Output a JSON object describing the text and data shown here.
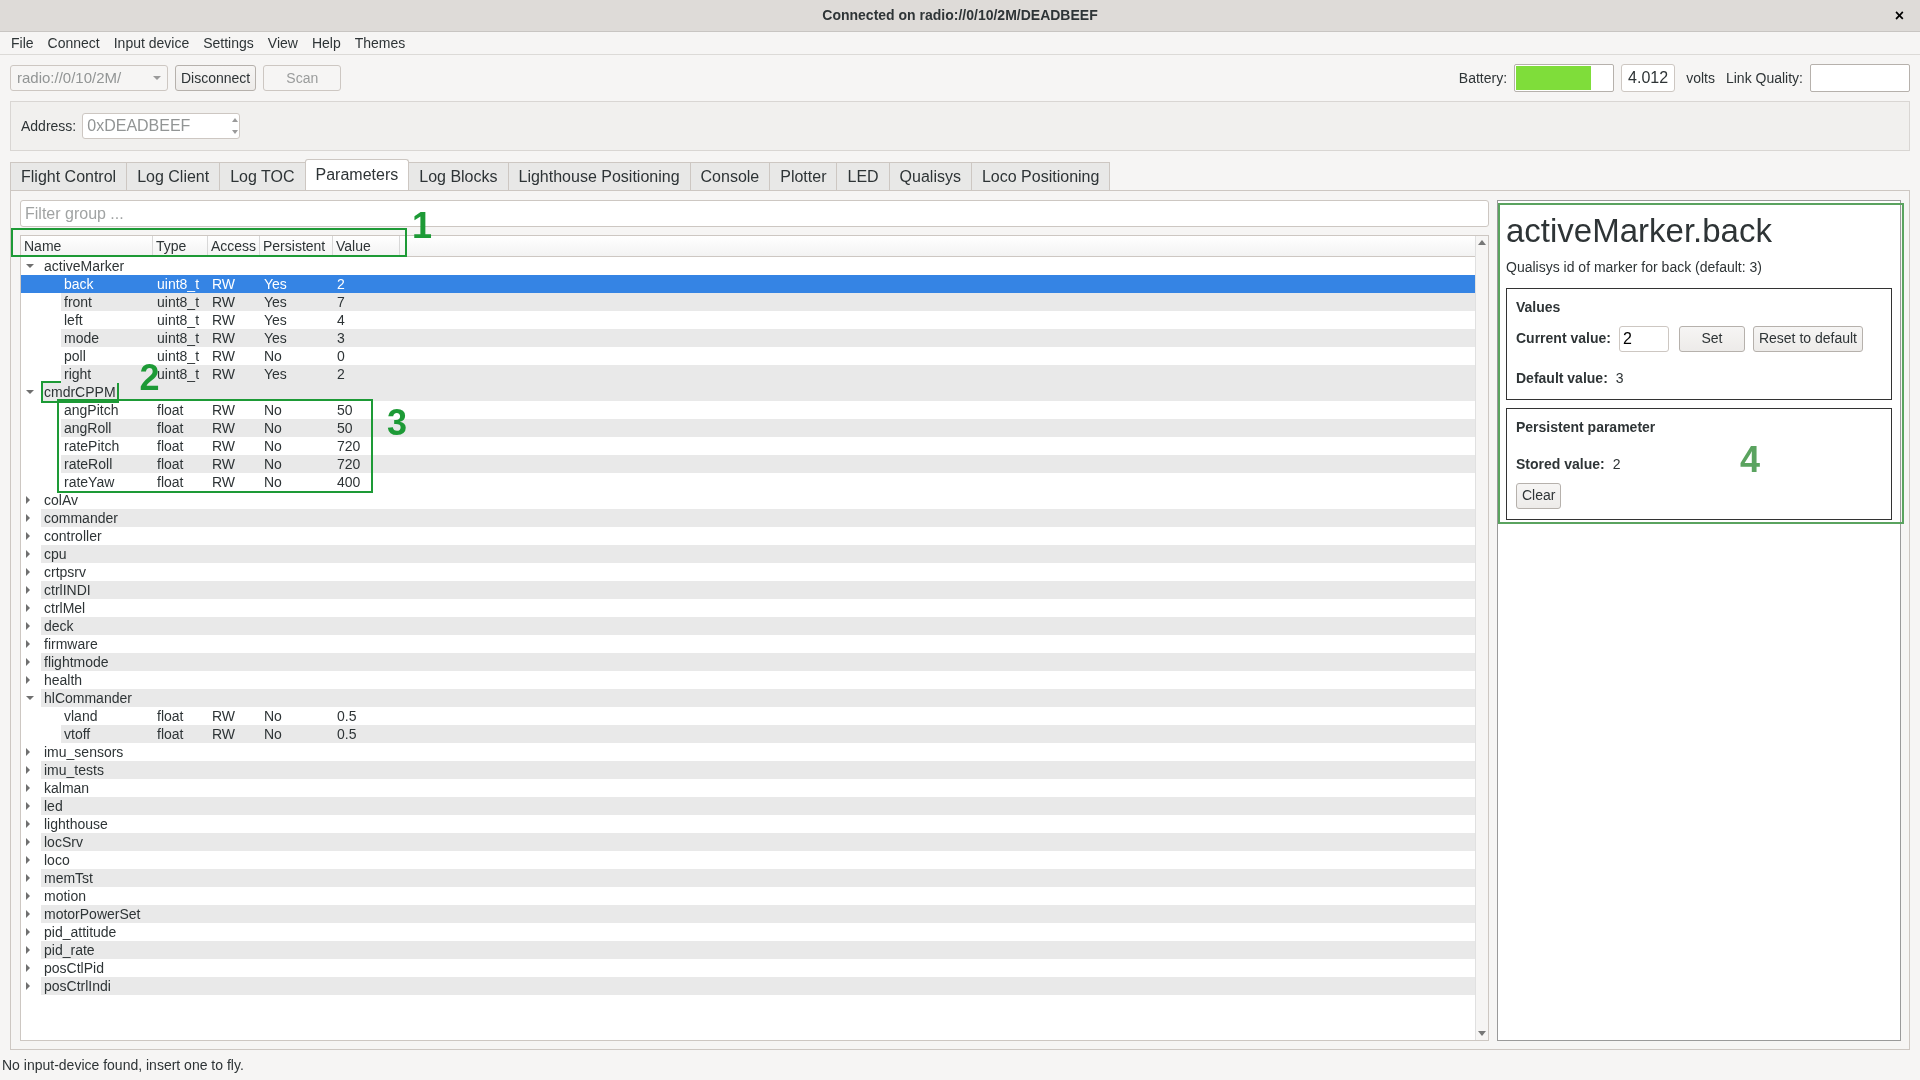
{
  "window": {
    "title": "Connected on radio://0/10/2M/DEADBEEF",
    "close": "×"
  },
  "menu": [
    "File",
    "Connect",
    "Input device",
    "Settings",
    "View",
    "Help",
    "Themes"
  ],
  "toolbar": {
    "uri": {
      "value": "radio://0/10/2M/",
      "disabled": true
    },
    "buttons": [
      {
        "label": "Disconnect",
        "disabled": false
      },
      {
        "label": "Scan",
        "disabled": true
      }
    ],
    "battery_label": "Battery:",
    "battery": {
      "level": 0.78
    },
    "voltage": "4.012",
    "voltage_unit": "volts",
    "link_quality_label": "Link Quality:"
  },
  "address": {
    "label": "Address:",
    "value": "0xDEADBEEF",
    "disabled": true
  },
  "tabs": [
    {
      "label": "Flight Control",
      "selected": false
    },
    {
      "label": "Log Client",
      "selected": false
    },
    {
      "label": "Log TOC",
      "selected": false
    },
    {
      "label": "Parameters",
      "selected": true
    },
    {
      "label": "Log Blocks",
      "selected": false
    },
    {
      "label": "Lighthouse Positioning",
      "selected": false
    },
    {
      "label": "Console",
      "selected": false
    },
    {
      "label": "Plotter",
      "selected": false
    },
    {
      "label": "LED",
      "selected": false
    },
    {
      "label": "Qualisys",
      "selected": false
    },
    {
      "label": "Loco Positioning",
      "selected": false
    }
  ],
  "filter": {
    "placeholder": "Filter group ..."
  },
  "tree": {
    "columns": [
      "Name",
      "Type",
      "Access",
      "Persistent",
      "Value"
    ],
    "callout": "1",
    "items": [
      {
        "kind": "group",
        "name": "activeMarker",
        "expanded": true,
        "selected": false,
        "children": [
          {
            "kind": "param",
            "name": "back",
            "type": "uint8_t",
            "access": "RW",
            "persistent": "Yes",
            "value": "2",
            "selected": true
          },
          {
            "kind": "param",
            "name": "front",
            "type": "uint8_t",
            "access": "RW",
            "persistent": "Yes",
            "value": "7",
            "selected": false
          },
          {
            "kind": "param",
            "name": "left",
            "type": "uint8_t",
            "access": "RW",
            "persistent": "Yes",
            "value": "4",
            "selected": false
          },
          {
            "kind": "param",
            "name": "mode",
            "type": "uint8_t",
            "access": "RW",
            "persistent": "Yes",
            "value": "3",
            "selected": false
          },
          {
            "kind": "param",
            "name": "poll",
            "type": "uint8_t",
            "access": "RW",
            "persistent": "No",
            "value": "0",
            "selected": false
          },
          {
            "kind": "param",
            "name": "right",
            "type": "uint8_t",
            "access": "RW",
            "persistent": "Yes",
            "value": "2",
            "selected": false
          }
        ]
      },
      {
        "kind": "group",
        "name": "cmdrCPPM",
        "expanded": true,
        "selected": false,
        "callout": "2",
        "children_callout": "3",
        "children": [
          {
            "kind": "param",
            "name": "angPitch",
            "type": "float",
            "access": "RW",
            "persistent": "No",
            "value": "50",
            "selected": false
          },
          {
            "kind": "param",
            "name": "angRoll",
            "type": "float",
            "access": "RW",
            "persistent": "No",
            "value": "50",
            "selected": false
          },
          {
            "kind": "param",
            "name": "ratePitch",
            "type": "float",
            "access": "RW",
            "persistent": "No",
            "value": "720",
            "selected": false
          },
          {
            "kind": "param",
            "name": "rateRoll",
            "type": "float",
            "access": "RW",
            "persistent": "No",
            "value": "720",
            "selected": false
          },
          {
            "kind": "param",
            "name": "rateYaw",
            "type": "float",
            "access": "RW",
            "persistent": "No",
            "value": "400",
            "selected": false
          }
        ]
      },
      {
        "kind": "group",
        "name": "colAv",
        "expanded": false,
        "selected": false
      },
      {
        "kind": "group",
        "name": "commander",
        "expanded": false,
        "selected": false
      },
      {
        "kind": "group",
        "name": "controller",
        "expanded": false,
        "selected": false
      },
      {
        "kind": "group",
        "name": "cpu",
        "expanded": false,
        "selected": false
      },
      {
        "kind": "group",
        "name": "crtpsrv",
        "expanded": false,
        "selected": false
      },
      {
        "kind": "group",
        "name": "ctrlINDI",
        "expanded": false,
        "selected": false
      },
      {
        "kind": "group",
        "name": "ctrlMel",
        "expanded": false,
        "selected": false
      },
      {
        "kind": "group",
        "name": "deck",
        "expanded": false,
        "selected": false
      },
      {
        "kind": "group",
        "name": "firmware",
        "expanded": false,
        "selected": false
      },
      {
        "kind": "group",
        "name": "flightmode",
        "expanded": false,
        "selected": false
      },
      {
        "kind": "group",
        "name": "health",
        "expanded": false,
        "selected": false
      },
      {
        "kind": "group",
        "name": "hlCommander",
        "expanded": true,
        "selected": false,
        "children": [
          {
            "kind": "param",
            "name": "vland",
            "type": "float",
            "access": "RW",
            "persistent": "No",
            "value": "0.5",
            "selected": false
          },
          {
            "kind": "param",
            "name": "vtoff",
            "type": "float",
            "access": "RW",
            "persistent": "No",
            "value": "0.5",
            "selected": false
          }
        ]
      },
      {
        "kind": "group",
        "name": "imu_sensors",
        "expanded": false,
        "selected": false
      },
      {
        "kind": "group",
        "name": "imu_tests",
        "expanded": false,
        "selected": false
      },
      {
        "kind": "group",
        "name": "kalman",
        "expanded": false,
        "selected": false
      },
      {
        "kind": "group",
        "name": "led",
        "expanded": false,
        "selected": false
      },
      {
        "kind": "group",
        "name": "lighthouse",
        "expanded": false,
        "selected": false
      },
      {
        "kind": "group",
        "name": "locSrv",
        "expanded": false,
        "selected": false
      },
      {
        "kind": "group",
        "name": "loco",
        "expanded": false,
        "selected": false
      },
      {
        "kind": "group",
        "name": "memTst",
        "expanded": false,
        "selected": false
      },
      {
        "kind": "group",
        "name": "motion",
        "expanded": false,
        "selected": false
      },
      {
        "kind": "group",
        "name": "motorPowerSet",
        "expanded": false,
        "selected": false
      },
      {
        "kind": "group",
        "name": "pid_attitude",
        "expanded": false,
        "selected": false
      },
      {
        "kind": "group",
        "name": "pid_rate",
        "expanded": false,
        "selected": false
      },
      {
        "kind": "group",
        "name": "posCtlPid",
        "expanded": false,
        "selected": false
      },
      {
        "kind": "group",
        "name": "posCtrlIndi",
        "expanded": false,
        "selected": false
      }
    ]
  },
  "detail": {
    "title": "activeMarker.back",
    "description": "Qualisys id of marker for back (default: 3)",
    "callout": "4",
    "values_group": {
      "title": "Values",
      "current_label": "Current value:",
      "current_value": "2",
      "set_button": "Set",
      "reset_button": "Reset to default",
      "default_label": "Default value:",
      "default_value": "3"
    },
    "persistent_group": {
      "title": "Persistent parameter",
      "stored_label": "Stored value:",
      "stored_value": "2",
      "clear_button": "Clear"
    }
  },
  "status_bar": "No input-device found, insert one to fly."
}
